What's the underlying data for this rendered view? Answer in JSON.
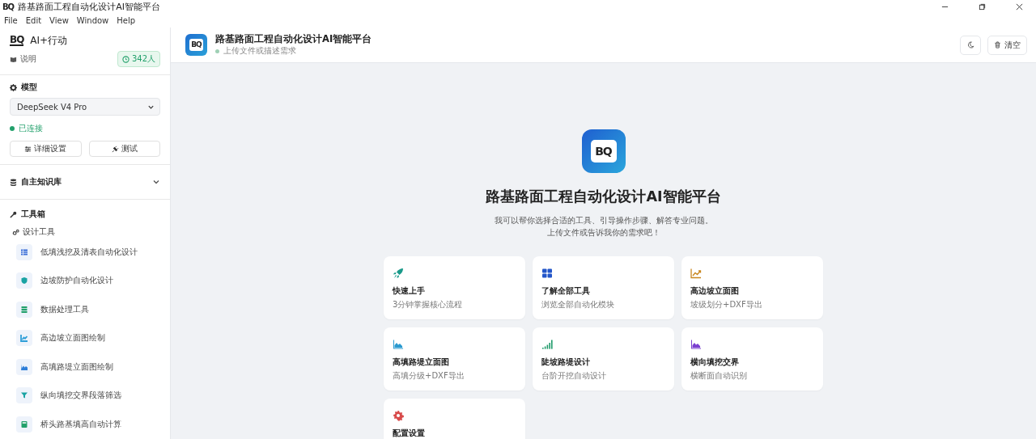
{
  "window": {
    "title": "路基路面工程自动化设计AI智能平台",
    "logo": "BQ"
  },
  "menu": [
    "File",
    "Edit",
    "View",
    "Window",
    "Help"
  ],
  "sidebar": {
    "brand": {
      "logo": "BQ",
      "name": "AI+行动"
    },
    "doc_link": "说明",
    "online_count": "342人",
    "model": {
      "heading": "模型",
      "value": "DeepSeek V4 Pro",
      "connected": true,
      "status": "已连接",
      "buttons": [
        {
          "kind": "settings",
          "label": "详细设置"
        },
        {
          "kind": "plug",
          "label": "测试"
        }
      ]
    },
    "knowledge": {
      "heading": "自主知识库",
      "expanded": false
    },
    "toolbox": {
      "heading": "工具箱",
      "group": "设计工具",
      "items": [
        {
          "kind": "table",
          "label": "低填浅挖及清表自动化设计",
          "color": "#3b6fd8"
        },
        {
          "kind": "shield",
          "label": "边坡防护自动化设计",
          "color": "#1aa3a3"
        },
        {
          "kind": "layers",
          "label": "数据处理工具",
          "color": "#22a06b"
        },
        {
          "kind": "line",
          "label": "高边坡立面图绘制",
          "color": "#2f9fd8"
        },
        {
          "kind": "area",
          "label": "高填路堤立面图绘制",
          "color": "#2f7fd8"
        },
        {
          "kind": "filter",
          "label": "纵向填挖交界段落筛选",
          "color": "#1aa3a3"
        },
        {
          "kind": "calc",
          "label": "桥头路基填高自动计算",
          "color": "#22a06b"
        }
      ]
    }
  },
  "header": {
    "logo": "BQ",
    "title": "路基路面工程自动化设计AI智能平台",
    "status": "上传文件或描述需求",
    "buttons": [
      {
        "kind": "moon"
      },
      {
        "kind": "trash",
        "label": "清空"
      }
    ]
  },
  "hero": {
    "logo": "BQ",
    "title": "路基路面工程自动化设计AI智能平台",
    "lines": [
      "我可以帮你选择合适的工具、引导操作步骤、解答专业问题。",
      "上传文件或告诉我你的需求吧！"
    ]
  },
  "cards": [
    {
      "kind": "rocket",
      "color": "#1a9a8a",
      "title": "快速上手",
      "desc": "3分钟掌握核心流程"
    },
    {
      "kind": "grid",
      "color": "#2356c9",
      "title": "了解全部工具",
      "desc": "浏览全部自动化模块"
    },
    {
      "kind": "line",
      "color": "#c8861e",
      "title": "高边坡立面图",
      "desc": "坡级划分+DXF导出"
    },
    {
      "kind": "area",
      "color": "#2a9ad0",
      "title": "高填路堤立面图",
      "desc": "高填分级+DXF导出"
    },
    {
      "kind": "bars",
      "color": "#1f9a6a",
      "title": "陡坡路堤设计",
      "desc": "台阶开挖自动设计"
    },
    {
      "kind": "area",
      "color": "#7b3fd0",
      "title": "横向填挖交界",
      "desc": "横断面自动识别"
    },
    {
      "kind": "gear",
      "color": "#d84a4a",
      "title": "配置设置"
    }
  ]
}
